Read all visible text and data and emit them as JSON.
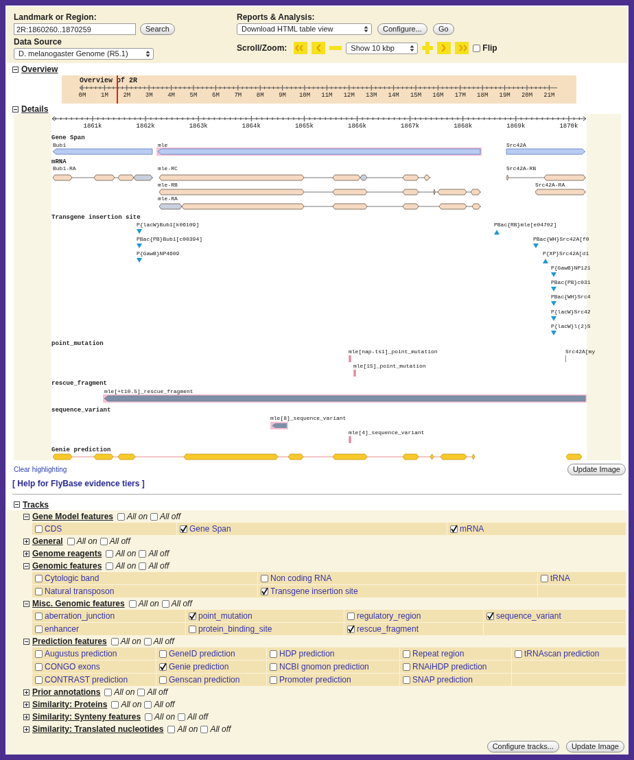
{
  "search": {
    "label": "Landmark or Region:",
    "value": "2R:1860260..1870259",
    "button": "Search"
  },
  "data_source": {
    "label": "Data Source",
    "value": "D. melanogaster Genome (R5.1)"
  },
  "reports": {
    "label": "Reports & Analysis:",
    "value": "Download HTML table view",
    "buttons": [
      "Configure...",
      "Go"
    ]
  },
  "scroll_zoom": {
    "label": "Scroll/Zoom:",
    "zoom_value": "Show 10 kbp",
    "flip": {
      "label": "Flip",
      "checked": false
    }
  },
  "overview": {
    "label": "Overview",
    "expanded": true,
    "title": "Overview of 2R",
    "ticks": [
      "0M",
      "1M",
      "2M",
      "3M",
      "4M",
      "5M",
      "6M",
      "7M",
      "8M",
      "9M",
      "10M",
      "11M",
      "12M",
      "13M",
      "14M",
      "15M",
      "16M",
      "17M",
      "18M",
      "19M",
      "20M",
      "21M"
    ]
  },
  "details": {
    "label": "Details",
    "expanded": true,
    "ruler_ticks": [
      "1861k",
      "1862k",
      "1863k",
      "1864k",
      "1865k",
      "1866k",
      "1867k",
      "1868k",
      "1869k",
      "1870k"
    ],
    "tracks": [
      {
        "kind": "span",
        "title": "Gene Span",
        "features": [
          {
            "label": "Bub1",
            "highlighted": false
          },
          {
            "label": "mle",
            "highlighted": true
          },
          {
            "label": "Src42A",
            "highlighted": false
          }
        ]
      },
      {
        "kind": "transcript",
        "title": "mRNA",
        "features": [
          {
            "label": "Bub1-RA",
            "highlighted": false
          },
          {
            "label": "mle-RC",
            "highlighted": false
          },
          {
            "label": "Src42A-RB",
            "highlighted": false
          },
          {
            "label": "mle-RB",
            "highlighted": false
          },
          {
            "label": "Src42A-RA",
            "highlighted": false
          },
          {
            "label": "mle-RA",
            "highlighted": false
          }
        ]
      },
      {
        "kind": "insertion",
        "title": "Transgene insertion site",
        "features": [
          {
            "label": "P{lacW}Bub1[k06109]",
            "highlighted": false
          },
          {
            "label": "PBac{PB}Bub1[c00394]",
            "highlighted": false
          },
          {
            "label": "P{GawB}NP4609",
            "highlighted": false
          },
          {
            "label": "PBac{RB}mle[e04702]",
            "highlighted": false
          },
          {
            "label": "PBac{WH}Src42A[f0",
            "highlighted": false
          },
          {
            "label": "P{XP}Src42A[d1",
            "highlighted": false
          },
          {
            "label": "P{GawB}NP121",
            "highlighted": false
          },
          {
            "label": "PBac{PB}c031",
            "highlighted": false
          },
          {
            "label": "PBac{WH}Src4",
            "highlighted": false
          },
          {
            "label": "P{lacW}Src42",
            "highlighted": false
          },
          {
            "label": "P{lacW}l(2)S",
            "highlighted": false
          }
        ]
      },
      {
        "kind": "point",
        "title": "point_mutation",
        "features": [
          {
            "label": "mle[nap-ts1]_point_mutation",
            "highlighted": true
          },
          {
            "label": "mle[15]_point_mutation",
            "highlighted": true
          },
          {
            "label": "Src42A[my",
            "highlighted": false
          }
        ]
      },
      {
        "kind": "segment",
        "title": "rescue_fragment",
        "features": [
          {
            "label": "mle[+t10.5]_rescue_fragment",
            "highlighted": true
          }
        ]
      },
      {
        "kind": "point",
        "title": "sequence_variant",
        "features": [
          {
            "label": "mle[8]_sequence_variant",
            "highlighted": true
          },
          {
            "label": "mle[4]_sequence_variant",
            "highlighted": true
          }
        ]
      },
      {
        "kind": "prediction",
        "title": "Genie prediction"
      }
    ]
  },
  "clear_highlighting": "Clear highlighting",
  "update_button": "Update Image",
  "help_link": "[ Help for FlyBase evidence tiers ]",
  "tracks": {
    "label": "Tracks",
    "expanded": true,
    "groups": [
      {
        "title": "Gene Model features",
        "expanded": true,
        "all_on": {
          "label": "All on",
          "checked": false
        },
        "all_off": {
          "label": "All off",
          "checked": false
        },
        "rows": [
          [
            {
              "label": "CDS",
              "checked": false
            },
            {
              "label": "Gene Span",
              "checked": true
            },
            {
              "label": "mRNA",
              "checked": true
            }
          ]
        ]
      },
      {
        "title": "General",
        "expanded": false,
        "all_on": {
          "label": "All on",
          "checked": false
        },
        "all_off": {
          "label": "All off",
          "checked": false
        }
      },
      {
        "title": "Genome reagents",
        "expanded": false,
        "all_on": {
          "label": "All on",
          "checked": false
        },
        "all_off": {
          "label": "All off",
          "checked": false
        }
      },
      {
        "title": "Genomic features",
        "expanded": true,
        "all_on": {
          "label": "All on",
          "checked": false
        },
        "all_off": {
          "label": "All off",
          "checked": false
        },
        "rows": [
          [
            {
              "label": "Cytologic band",
              "checked": false
            },
            {
              "label": "Non coding RNA",
              "checked": false
            },
            {
              "label": "tRNA",
              "checked": false
            }
          ],
          [
            {
              "label": "Natural transposon",
              "checked": false
            },
            {
              "label": "Transgene insertion site",
              "checked": true
            }
          ]
        ]
      },
      {
        "title": "Misc. Genomic features",
        "expanded": true,
        "all_on": {
          "label": "All on",
          "checked": false
        },
        "all_off": {
          "label": "All off",
          "checked": false
        },
        "rows": [
          [
            {
              "label": "aberration_junction",
              "checked": false
            },
            {
              "label": "point_mutation",
              "checked": true
            },
            {
              "label": "regulatory_region",
              "checked": false
            },
            {
              "label": "sequence_variant",
              "checked": true
            }
          ],
          [
            {
              "label": "enhancer",
              "checked": false
            },
            {
              "label": "protein_binding_site",
              "checked": false
            },
            {
              "label": "rescue_fragment",
              "checked": true
            }
          ]
        ]
      },
      {
        "title": "Prediction features",
        "expanded": true,
        "all_on": {
          "label": "All on",
          "checked": false
        },
        "all_off": {
          "label": "All off",
          "checked": false
        },
        "rows": [
          [
            {
              "label": "Augustus prediction",
              "checked": false
            },
            {
              "label": "GeneID prediction",
              "checked": false
            },
            {
              "label": "HDP prediction",
              "checked": false
            },
            {
              "label": "Repeat region",
              "checked": false
            },
            {
              "label": "tRNAscan prediction",
              "checked": false
            }
          ],
          [
            {
              "label": "CONGO exons",
              "checked": false
            },
            {
              "label": "Genie prediction",
              "checked": true
            },
            {
              "label": "NCBI gnomon prediction",
              "checked": false
            },
            {
              "label": "RNAiHDP prediction",
              "checked": false
            }
          ],
          [
            {
              "label": "CONTRAST prediction",
              "checked": false
            },
            {
              "label": "Genscan prediction",
              "checked": false
            },
            {
              "label": "Promoter prediction",
              "checked": false
            },
            {
              "label": "SNAP prediction",
              "checked": false
            }
          ]
        ]
      },
      {
        "title": "Prior annotations",
        "expanded": false,
        "all_on": {
          "label": "All on",
          "checked": false
        },
        "all_off": {
          "label": "All off",
          "checked": false
        }
      },
      {
        "title": "Similarity: Proteins",
        "expanded": false,
        "all_on": {
          "label": "All on",
          "checked": false
        },
        "all_off": {
          "label": "All off",
          "checked": false
        }
      },
      {
        "title": "Similarity: Synteny features",
        "expanded": false,
        "all_on": {
          "label": "All on",
          "checked": false
        },
        "all_off": {
          "label": "All off",
          "checked": false
        }
      },
      {
        "title": "Similarity: Translated nucleotides",
        "expanded": false,
        "all_on": {
          "label": "All on",
          "checked": false
        },
        "all_off": {
          "label": "All off",
          "checked": false
        }
      }
    ]
  },
  "footer_buttons": [
    "Configure tracks...",
    "Update Image"
  ]
}
